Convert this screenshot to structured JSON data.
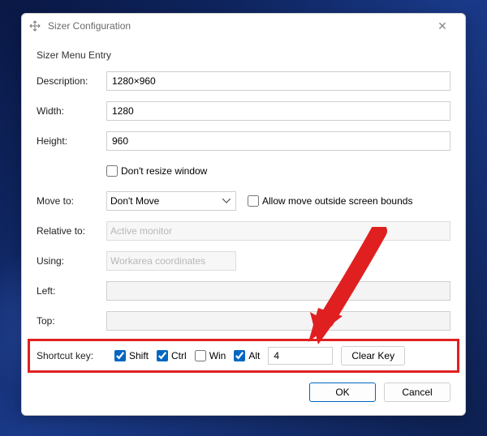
{
  "window": {
    "title": "Sizer Configuration"
  },
  "group": {
    "label": "Sizer Menu Entry"
  },
  "labels": {
    "description": "Description:",
    "width": "Width:",
    "height": "Height:",
    "dontResize": "Don't resize window",
    "moveTo": "Move to:",
    "allowOutside": "Allow move outside screen bounds",
    "relativeTo": "Relative to:",
    "using": "Using:",
    "left": "Left:",
    "top": "Top:",
    "shortcut": "Shortcut key:",
    "shift": "Shift",
    "ctrl": "Ctrl",
    "win": "Win",
    "alt": "Alt",
    "clearKey": "Clear Key",
    "ok": "OK",
    "cancel": "Cancel"
  },
  "values": {
    "description": "1280×960",
    "width": "1280",
    "height": "960",
    "dontResize": false,
    "moveTo": "Don't Move",
    "allowOutside": false,
    "relativeTo": "Active monitor",
    "using": "Workarea coordinates",
    "left": "",
    "top": "",
    "shift": true,
    "ctrl": true,
    "win": false,
    "alt": true,
    "shortcutKey": "4"
  }
}
